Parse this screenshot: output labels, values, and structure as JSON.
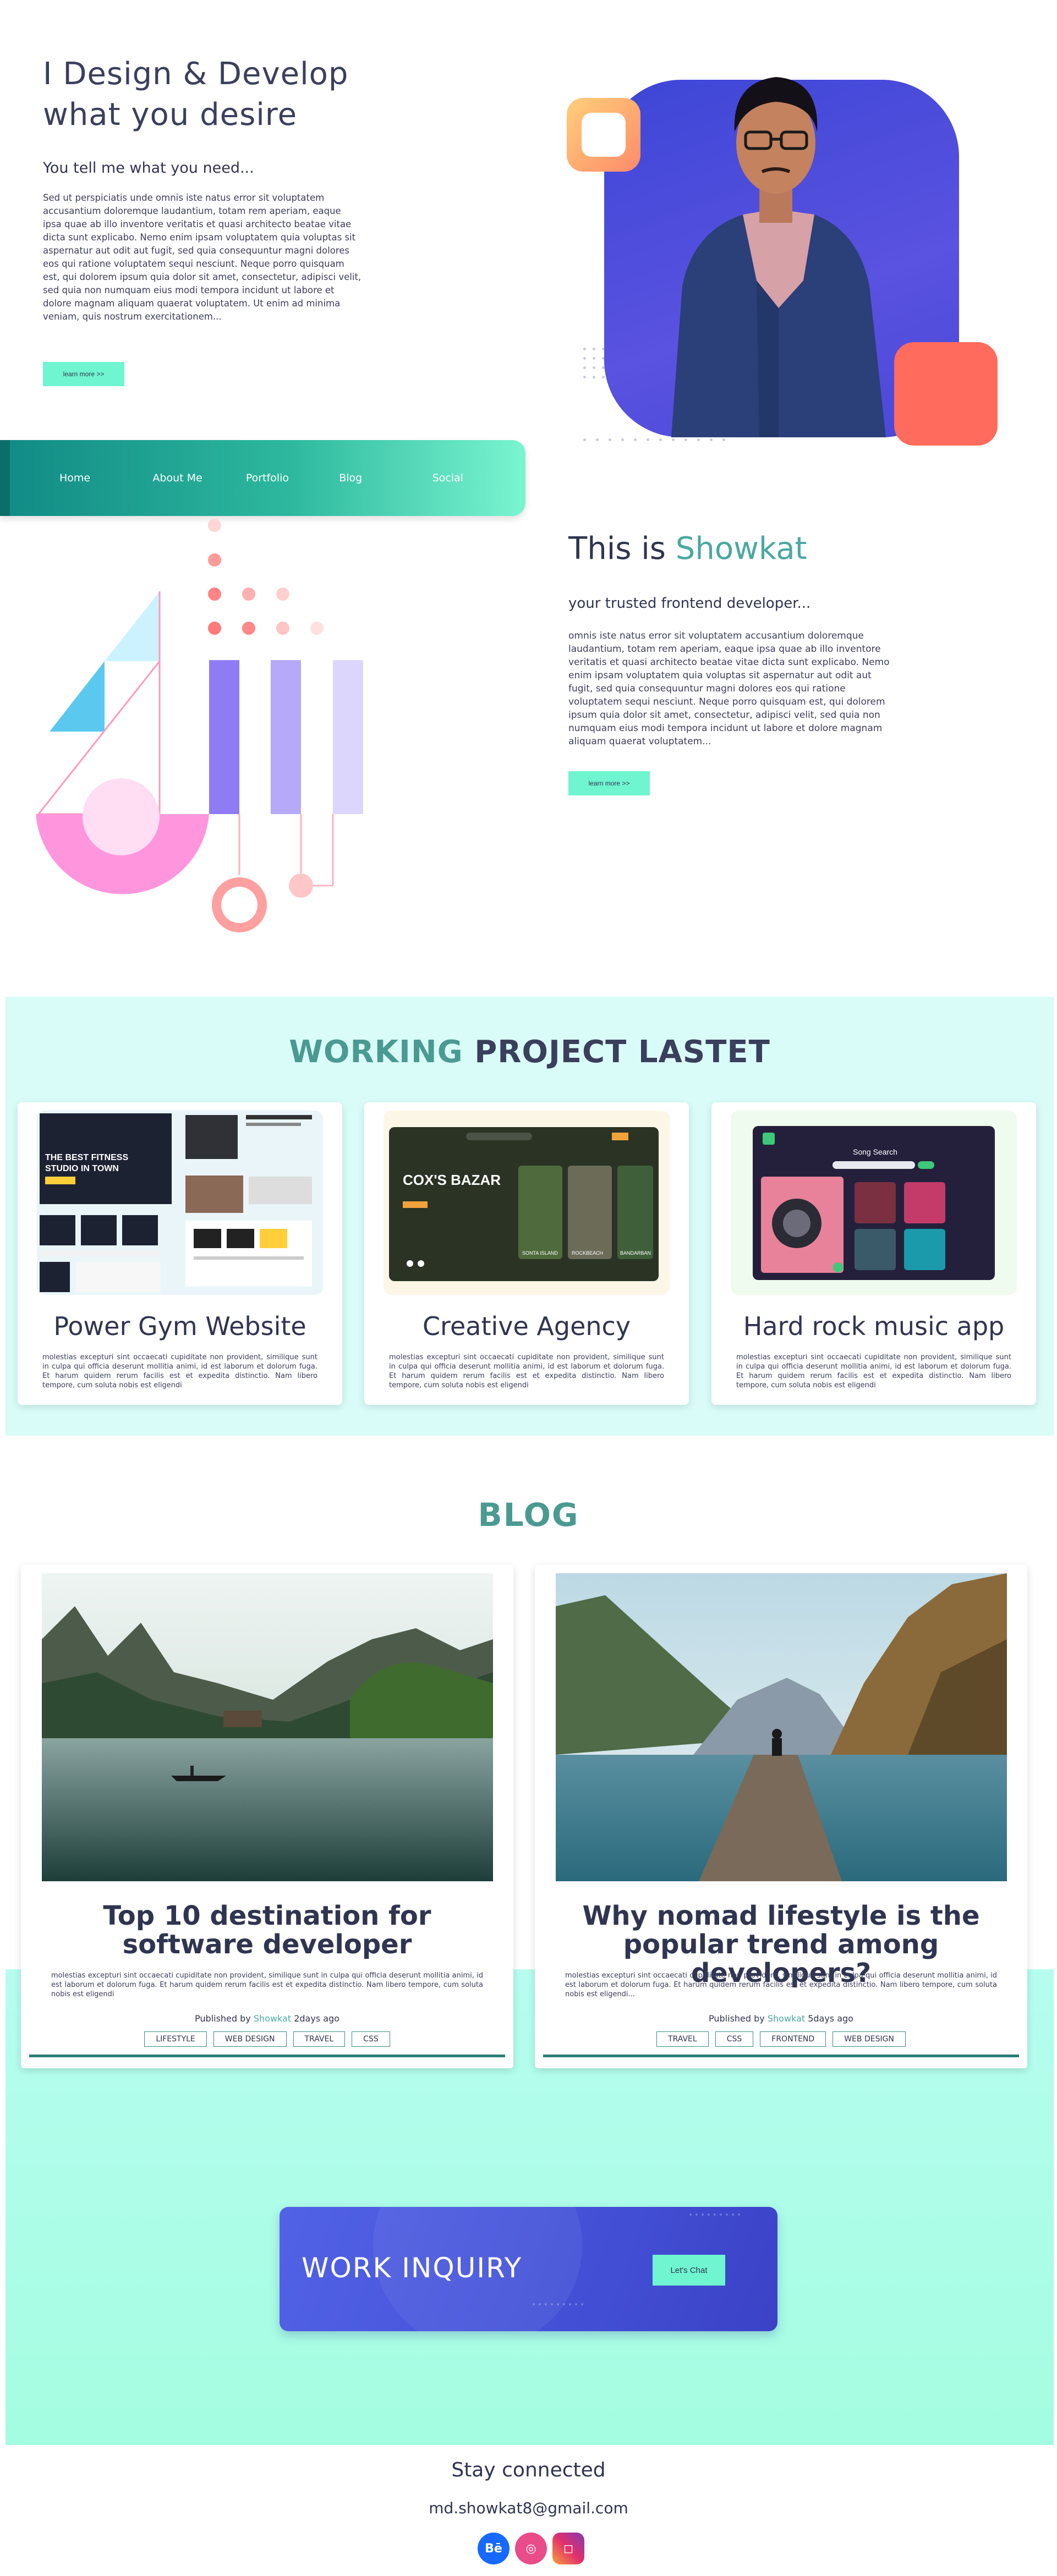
{
  "hero": {
    "title_line1": "I Design & Develop",
    "title_line2": "what you desire",
    "subtitle": "You tell me what you need...",
    "body": "Sed ut perspiciatis unde omnis iste natus error sit voluptatem accusantium doloremque laudantium, totam rem aperiam, eaque ipsa quae ab illo inventore veritatis et quasi architecto beatae vitae dicta sunt explicabo. Nemo enim ipsam voluptatem quia voluptas sit aspernatur aut odit aut fugit, sed quia consequuntur magni dolores eos qui ratione voluptatem sequi nesciunt. Neque porro quisquam est, qui dolorem ipsum quia dolor sit amet, consectetur, adipisci velit, sed quia non numquam eius modi tempora incidunt ut labore et dolore magnam aliquam quaerat voluptatem. Ut enim ad minima veniam, quis nostrum exercitationem...",
    "button": "learn more >>"
  },
  "nav": {
    "items": [
      "Home",
      "About Me",
      "Portfolio",
      "Blog",
      "Social"
    ]
  },
  "about": {
    "title_prefix": "This is",
    "title_name": "Showkat",
    "subtitle": "your trusted frontend developer...",
    "body": "omnis iste natus error sit voluptatem accusantium doloremque laudantium, totam rem aperiam, eaque ipsa quae ab illo inventore veritatis et quasi architecto beatae vitae dicta sunt explicabo. Nemo enim ipsam voluptatem quia voluptas sit aspernatur aut odit aut fugit, sed quia consequuntur magni dolores eos qui ratione voluptatem sequi nesciunt. Neque porro quisquam est, qui dolorem ipsum quia dolor sit amet, consectetur, adipisci velit, sed quia non numquam eius modi tempora incidunt ut labore et dolore magnam aliquam quaerat voluptatem...",
    "button": "learn more >>"
  },
  "projects": {
    "title_accent": "WORKING",
    "title_rest": "PROJECT LASTET",
    "items": [
      {
        "name": "Power Gym Website",
        "description": "molestias excepturi sint occaecati cupiditate non provident, similique sunt in culpa qui officia deserunt mollitia animi, id est laborum et dolorum fuga. Et harum quidem rerum facilis est et expedita distinctio. Nam libero tempore, cum soluta nobis est eligendi",
        "thumb_text": [
          "THE BEST FITNESS",
          "STUDIO IN TOWN"
        ]
      },
      {
        "name": "Creative Agency",
        "description": "molestias excepturi sint occaecati cupiditate non provident, similique sunt in culpa qui officia deserunt mollitia animi, id est laborum et dolorum fuga. Et harum quidem rerum facilis est et expedita distinctio. Nam libero tempore, cum soluta nobis est eligendi",
        "thumb_text": [
          "COX'S BAZAR",
          "SONTA ISLAND",
          "ROCKBEACH",
          "BANDARBAN"
        ]
      },
      {
        "name": "Hard rock music app",
        "description": "molestias excepturi sint occaecati cupiditate non provident, similique sunt in culpa qui officia deserunt mollitia animi, id est laborum et dolorum fuga. Et harum quidem rerum facilis est et expedita distinctio. Nam libero tempore, cum soluta nobis est eligendi",
        "thumb_text": [
          "Song Search"
        ]
      }
    ]
  },
  "blog": {
    "title": "BLOG",
    "posts": [
      {
        "title": "Top 10 destination for software developer",
        "description": "molestias excepturi sint occaecati cupiditate non provident, similique sunt in culpa qui officia deserunt mollitia animi, id est laborum et dolorum fuga. Et harum quidem rerum facilis est et expedita distinctio. Nam libero tempore, cum soluta nobis est eligendi",
        "published_by": "Published by",
        "author": "Showkat",
        "ago": "2days ago",
        "tags": [
          "LIFESTYLE",
          "WEB DESIGN",
          "TRAVEL",
          "CSS"
        ]
      },
      {
        "title": "Why nomad lifestyle is the popular trend among developers?",
        "description": "molestias excepturi sint occaecati cupiditate non provident, similique sunt in culpa qui officia deserunt mollitia animi, id est laborum et dolorum fuga. Et harum quidem rerum facilis est et expedita distinctio. Nam libero tempore, cum soluta nobis est eligendi...",
        "published_by": "Published by",
        "author": "Showkat",
        "ago": "5days ago",
        "tags": [
          "TRAVEL",
          "CSS",
          "FRONTEND",
          "WEB DESIGN"
        ]
      }
    ]
  },
  "inquiry": {
    "title": "WORK INQUIRY",
    "button": "Let's Chat"
  },
  "footer": {
    "heading": "Stay connected",
    "email": "md.showkat8@gmail.com",
    "socials": [
      {
        "icon": "behance-icon",
        "glyph": "Bē",
        "color": "#1769ff"
      },
      {
        "icon": "dribbble-icon",
        "glyph": "◎",
        "color": "#ea4c89"
      },
      {
        "icon": "instagram-icon",
        "glyph": "◻",
        "color": "#c13584"
      }
    ]
  },
  "colors": {
    "accent_teal": "#4aa8a0",
    "mint": "#6ff5cf",
    "indigo": "#4452d8",
    "coral": "#ff6b5c"
  }
}
